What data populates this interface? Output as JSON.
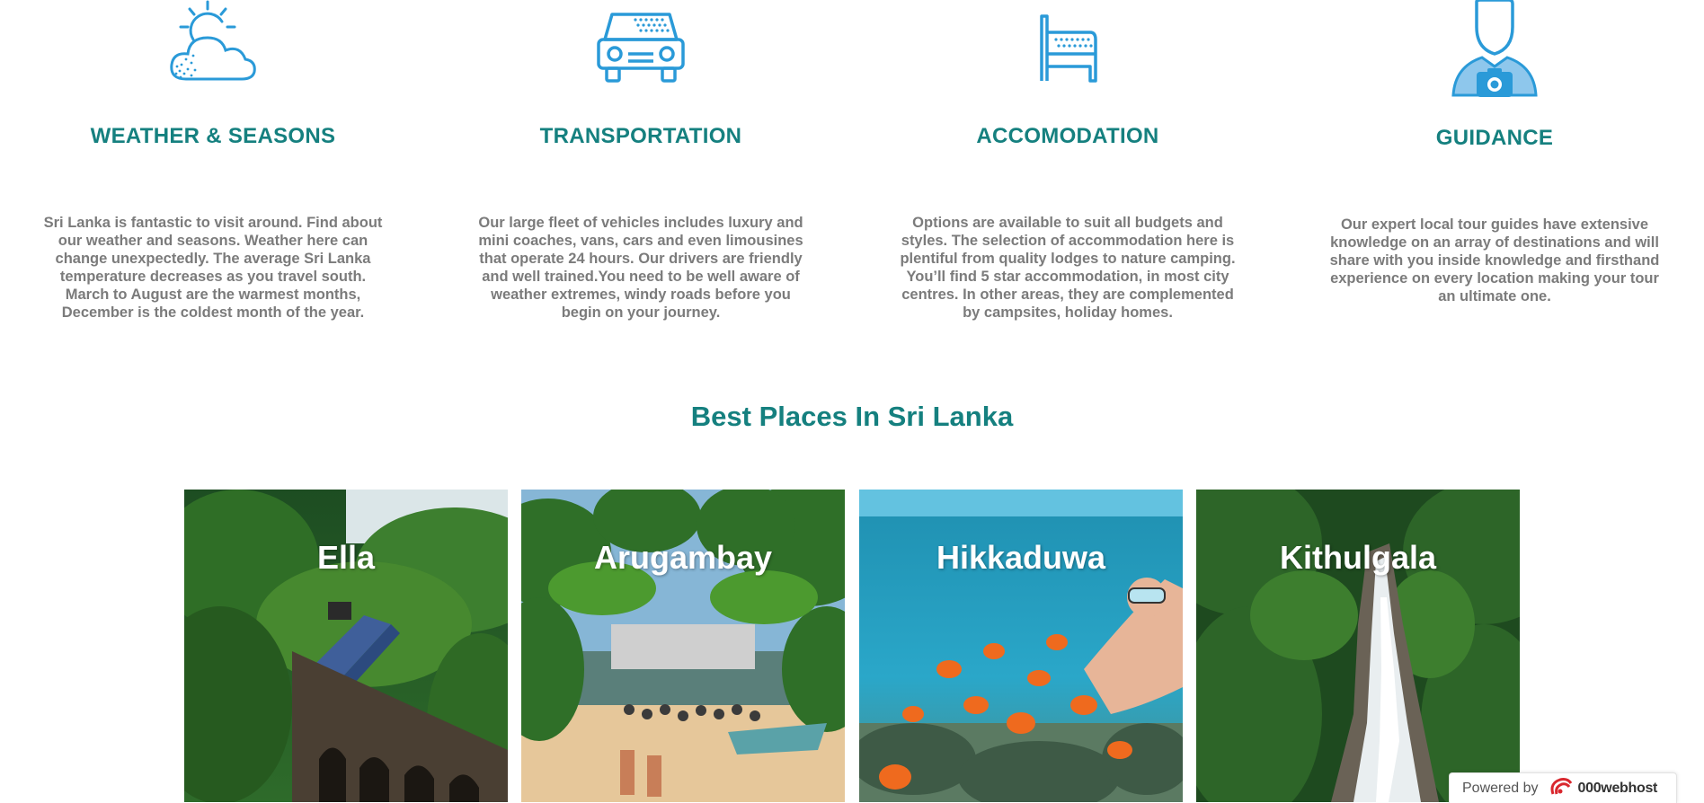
{
  "features": [
    {
      "icon": "weather-icon",
      "title": "WEATHER & SEASONS",
      "description": "Sri Lanka is fantastic to visit around. Find about our weather and seasons. Weather here can change unexpectedly. The average Sri Lanka temperature decreases as you travel south. March to August are the warmest months, December is the coldest month of the year."
    },
    {
      "icon": "car-icon",
      "title": "TRANSPORTATION",
      "description": "Our large fleet of vehicles includes luxury and mini coaches, vans, cars and even limousines that operate 24 hours. Our drivers are friendly and well trained.You need to be well aware of weather extremes, windy roads before you begin on your journey."
    },
    {
      "icon": "bed-icon",
      "title": "ACCOMODATION",
      "description": "Options are available to suit all budgets and styles. The selection of accommodation here is plentiful from quality lodges to nature camping. You’ll find 5 star accommodation, in most city centres. In other areas, they are complemented by campsites, holiday homes."
    },
    {
      "icon": "guide-photographer-icon",
      "title": "GUIDANCE",
      "description": "Our expert local tour guides have extensive knowledge on an array of destinations and will share with you inside knowledge and firsthand experience on every location making your tour an ultimate one."
    }
  ],
  "places_section": {
    "title": "Best Places In Sri Lanka",
    "places": [
      {
        "name": "Ella"
      },
      {
        "name": "Arugambay"
      },
      {
        "name": "Hikkaduwa"
      },
      {
        "name": "Kithulgala"
      }
    ]
  },
  "badge": {
    "prefix": "Powered by",
    "brand": "000webhost"
  },
  "colors": {
    "accent": "#15807f",
    "icon_blue": "#2a9ad8",
    "body_text": "#7b7b7b"
  }
}
